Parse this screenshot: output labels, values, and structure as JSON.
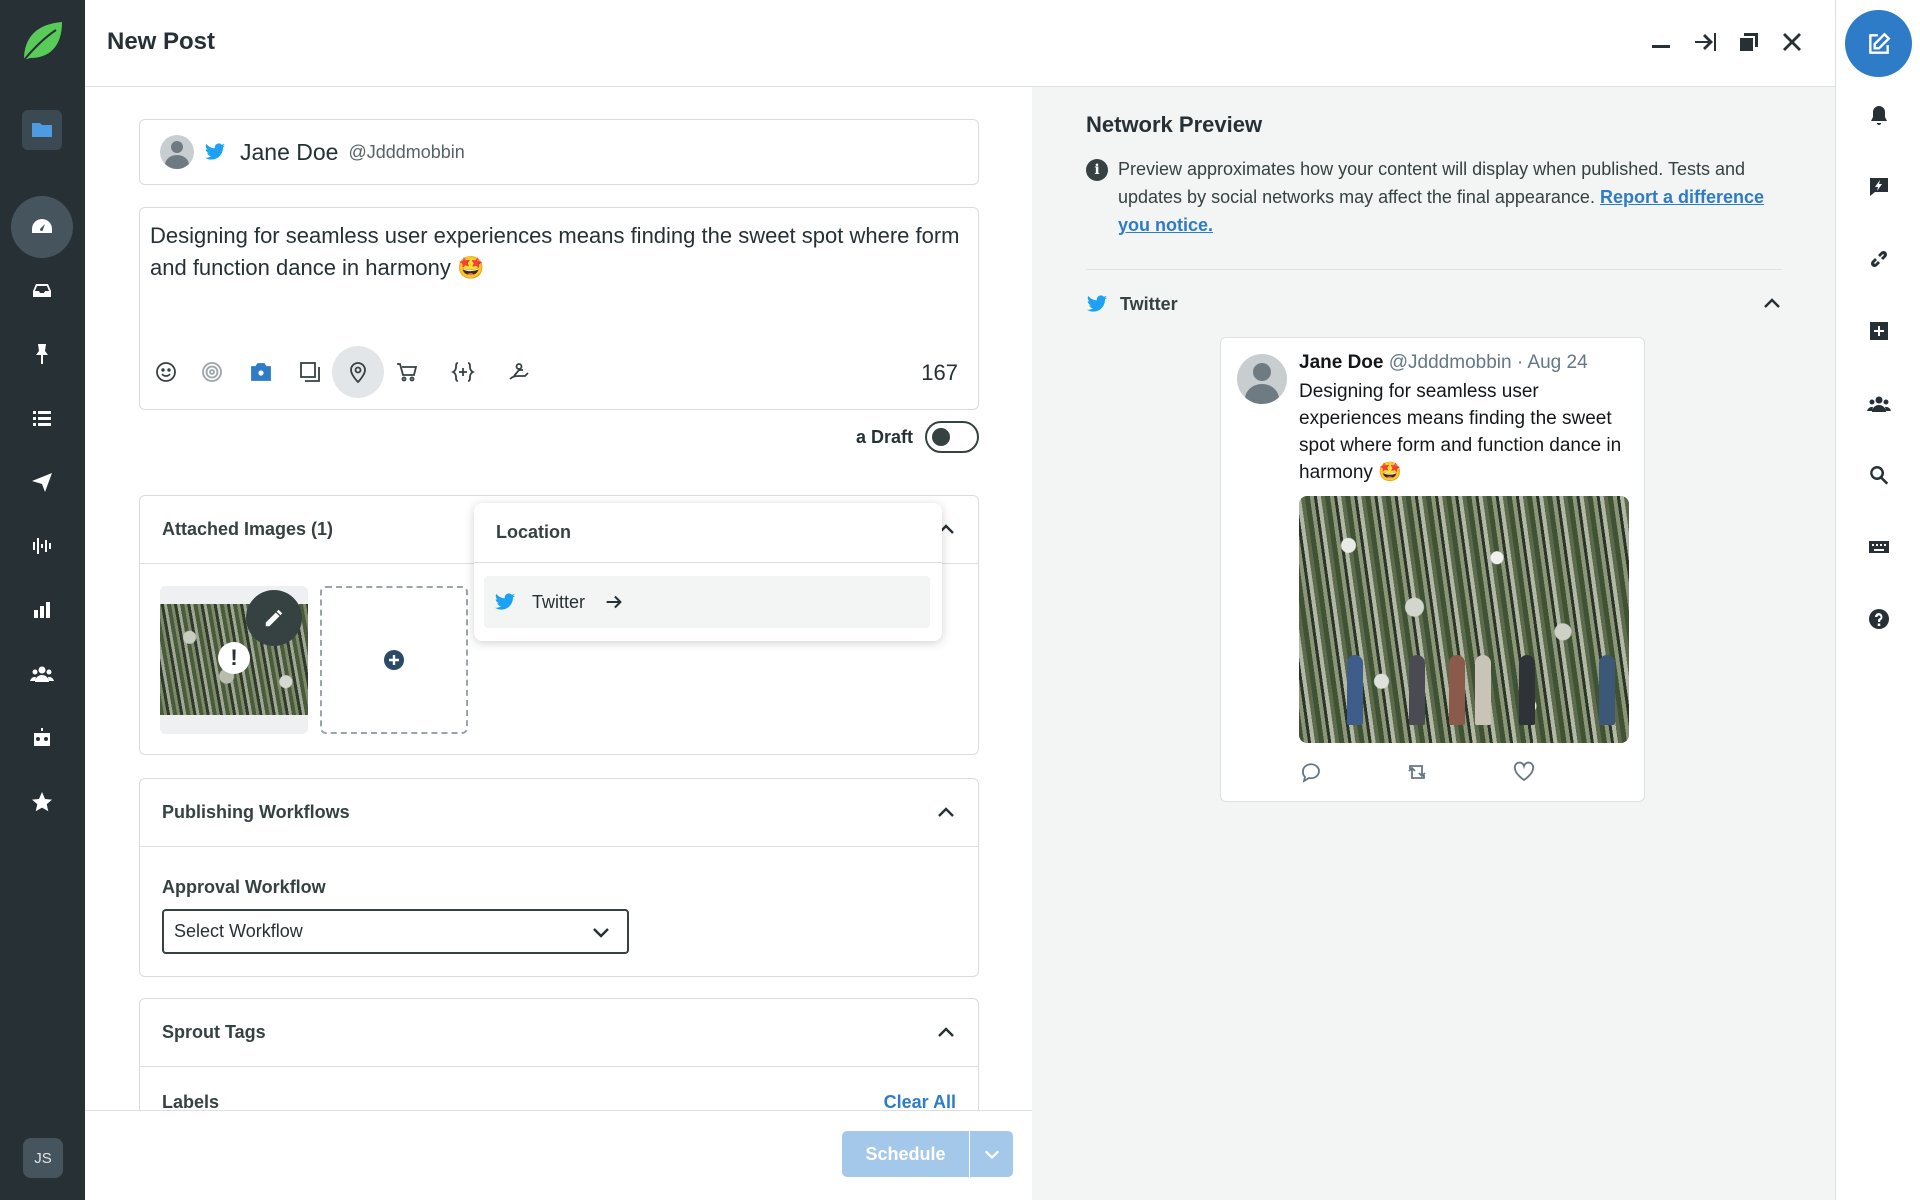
{
  "header": {
    "title": "New Post"
  },
  "left_nav": {
    "items": [
      "folder-icon",
      "dashboard-icon",
      "inbox-icon",
      "pin-icon",
      "list-icon",
      "send-icon",
      "listening-icon",
      "reports-icon",
      "people-icon",
      "bot-icon",
      "star-icon"
    ],
    "avatar_initials": "JS"
  },
  "profile": {
    "name": "Jane Doe",
    "handle": "@Jdddmobbin",
    "network_icon": "twitter-icon"
  },
  "message": {
    "text": "Designing for seamless user experiences means finding the sweet spot where form and function dance in harmony 🤩",
    "char_count": "167",
    "tools": [
      "emoji-icon",
      "target-icon",
      "camera-icon",
      "gallery-icon",
      "location-icon",
      "cart-icon",
      "variable-icon",
      "hand-icon"
    ]
  },
  "draft": {
    "label": "a Draft",
    "enabled": false
  },
  "location_menu": {
    "title": "Location",
    "item_label": "Twitter"
  },
  "attached_images": {
    "title": "Attached Images (1)",
    "count": 1
  },
  "publishing_workflows": {
    "title": "Publishing Workflows",
    "field_label": "Approval Workflow",
    "select_value": "Select Workflow"
  },
  "sprout_tags": {
    "title": "Sprout Tags",
    "labels_title": "Labels",
    "clear_label": "Clear All"
  },
  "footer": {
    "schedule_label": "Schedule"
  },
  "preview": {
    "title": "Network Preview",
    "note": "Preview approximates how your content will display when published. Tests and updates by social networks may affect the final appearance.",
    "link_text": "Report a difference you notice.",
    "network_label": "Twitter",
    "tweet": {
      "name": "Jane Doe",
      "handle": "@Jdddmobbin",
      "date": "· Aug 24",
      "text": "Designing for seamless user experiences means finding the sweet spot where form and function dance in harmony 🤩"
    }
  },
  "right_rail": {
    "items": [
      "compose-icon",
      "bell-icon",
      "feedback-icon",
      "link-icon",
      "plus-square-icon",
      "group-icon",
      "search-icon",
      "keyboard-icon",
      "help-icon"
    ]
  },
  "colors": {
    "nav_bg": "#273135",
    "accent": "#2e7cc7",
    "twitter": "#1da1f2",
    "preview_bg": "#f3f4f4",
    "logo": "#59cb59"
  }
}
